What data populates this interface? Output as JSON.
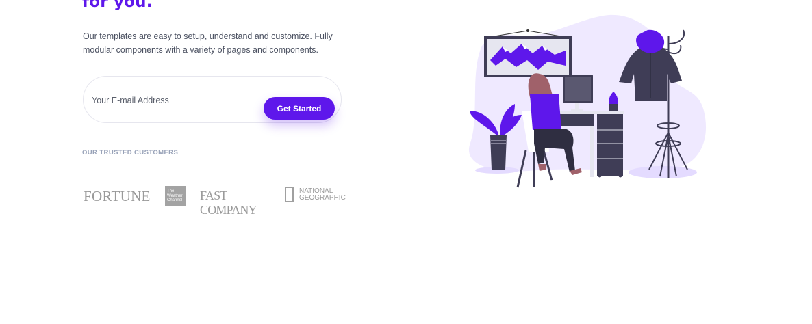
{
  "hero": {
    "title_fragment": "for you.",
    "description": "Our templates are easy to setup, understand and customize. Fully modular components with a variety of pages and components."
  },
  "subscribe": {
    "email_placeholder": "Your E-mail Address",
    "email_value": "",
    "button_label": "Get Started"
  },
  "trusted": {
    "heading": "OUR TRUSTED CUSTOMERS",
    "logos": {
      "fortune": "FORTUNE",
      "weather_channel": [
        "The",
        "Weather",
        "Channel"
      ],
      "fast_company": "FAST COMPANY",
      "national_geographic": [
        "NATIONAL",
        "GEOGRAPHIC"
      ]
    }
  },
  "colors": {
    "accent": "#5e17eb",
    "text": "#4a5060",
    "muted": "#98a2b8",
    "logo_gray": "#9a9a9a",
    "illustration_bg": "#efe9ff"
  },
  "illustration": {
    "subject": "person-working-at-desk-illustration"
  }
}
